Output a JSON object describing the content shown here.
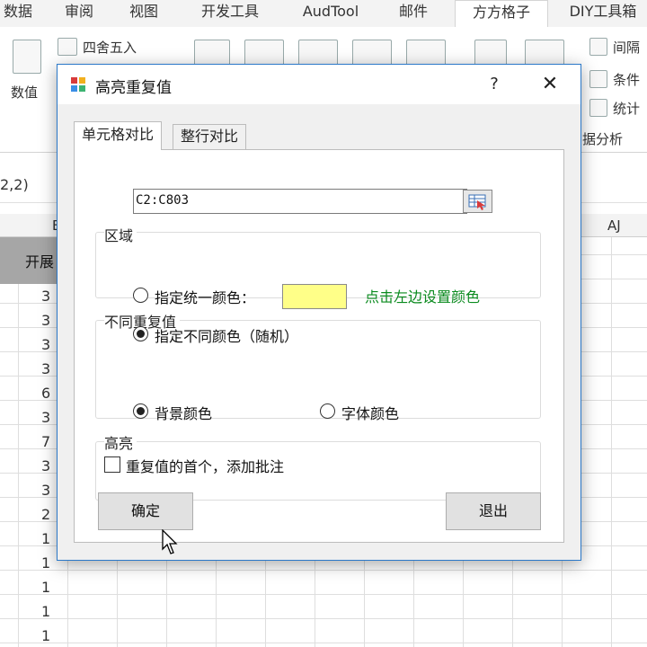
{
  "excel": {
    "tabs": [
      "数据",
      "审阅",
      "视图",
      "开发工具",
      "AudTool",
      "邮件",
      "方方格子",
      "DIY工具箱"
    ],
    "active_tab": "方方格子",
    "ribbon": {
      "rounding_label": "四舍五入",
      "value_label": "数值",
      "interval_label": "间隔",
      "condition_label": "条件",
      "stats_label": "统计",
      "analysis_label": "据分析"
    },
    "name_box_fragment": "2,2)",
    "col_label_b": "E",
    "col_label_aj": "AJ",
    "header_cell_fragment": "开展",
    "row_values": [
      "3",
      "3",
      "3",
      "3",
      "6",
      "3",
      "7",
      "3",
      "3",
      "2",
      "1",
      "1",
      "1",
      "1",
      "1"
    ]
  },
  "dialog": {
    "title": "高亮重复值",
    "help": "?",
    "close": "✕",
    "tabs": {
      "cell_compare": "单元格对比",
      "row_compare": "整行对比"
    },
    "range": {
      "label": "区域",
      "value": "C2:C803"
    },
    "dup_colors": {
      "label": "不同重复值",
      "uniform_label": "指定统一颜色：",
      "swatch_color": "#ffff88",
      "hint": "点击左边设置颜色",
      "random_label": "指定不同颜色（随机）",
      "selected": "random"
    },
    "highlight": {
      "label": "高亮",
      "bg_label": "背景颜色",
      "font_label": "字体颜色",
      "selected": "background"
    },
    "annotate": {
      "label": "重复值的首个，添加批注",
      "checked": false
    },
    "buttons": {
      "ok": "确定",
      "exit": "退出"
    }
  }
}
